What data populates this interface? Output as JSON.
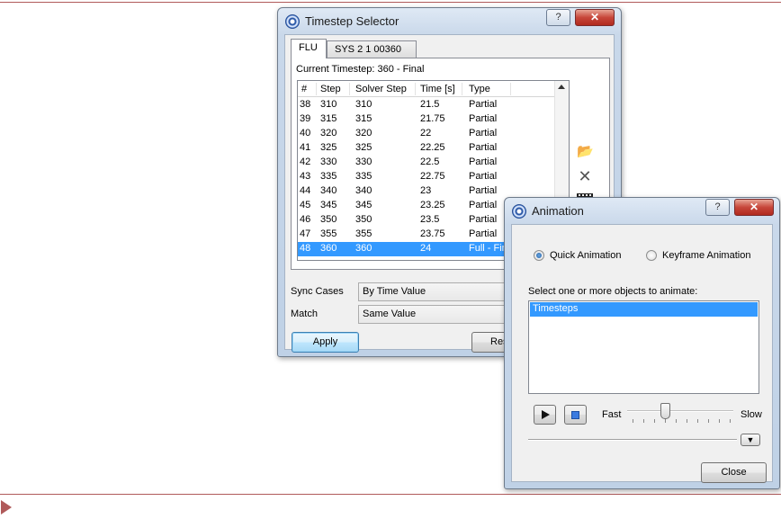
{
  "timestep": {
    "title": "Timestep Selector",
    "help": "?",
    "close": "✕",
    "tabs": [
      "FLU",
      "SYS 2 1 00360"
    ],
    "current": "Current Timestep: 360 - Final",
    "columns": [
      "#",
      "Step",
      "Solver Step",
      "Time [s]",
      "Type"
    ],
    "rows": [
      [
        "38",
        "310",
        "310",
        "21.5",
        "Partial"
      ],
      [
        "39",
        "315",
        "315",
        "21.75",
        "Partial"
      ],
      [
        "40",
        "320",
        "320",
        "22",
        "Partial"
      ],
      [
        "41",
        "325",
        "325",
        "22.25",
        "Partial"
      ],
      [
        "42",
        "330",
        "330",
        "22.5",
        "Partial"
      ],
      [
        "43",
        "335",
        "335",
        "22.75",
        "Partial"
      ],
      [
        "44",
        "340",
        "340",
        "23",
        "Partial"
      ],
      [
        "45",
        "345",
        "345",
        "23.25",
        "Partial"
      ],
      [
        "46",
        "350",
        "350",
        "23.5",
        "Partial"
      ],
      [
        "47",
        "355",
        "355",
        "23.75",
        "Partial"
      ],
      [
        "48",
        "360",
        "360",
        "24",
        "Full - Fina"
      ]
    ],
    "side_icons": [
      "open-folder-icon",
      "delete-x-icon",
      "film-strip-icon"
    ],
    "sync_label": "Sync Cases",
    "sync_value": "By Time Value",
    "match_label": "Match",
    "match_value": "Same Value",
    "apply": "Apply",
    "reset": "Res"
  },
  "animation": {
    "title": "Animation",
    "help": "?",
    "close": "✕",
    "quick": "Quick Animation",
    "keyframe": "Keyframe Animation",
    "select_label": "Select one or more objects to animate:",
    "objects": [
      "Timesteps"
    ],
    "fast": "Fast",
    "slow": "Slow",
    "speed_fraction": 0.35,
    "close_btn": "Close"
  }
}
